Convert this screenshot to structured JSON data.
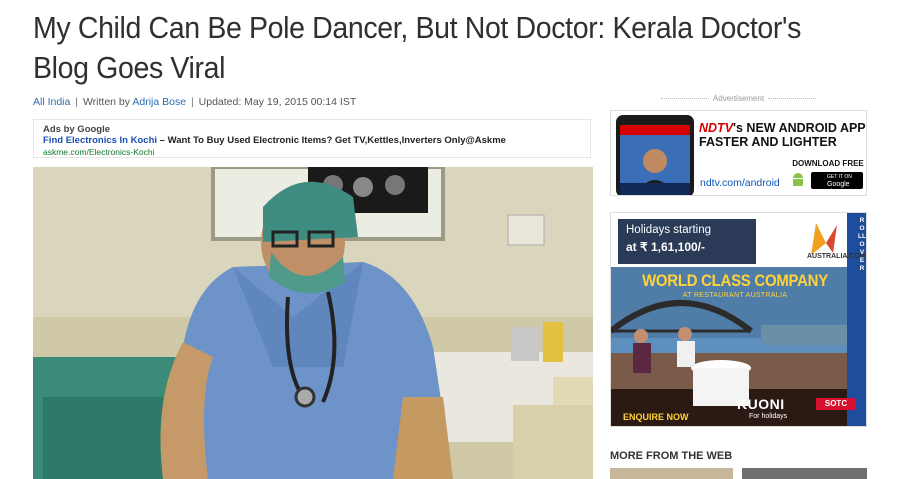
{
  "article": {
    "title": "My Child Can Be Pole Dancer, But Not Doctor: Kerala Doctor's Blog Goes Viral",
    "byline": {
      "section": "All India",
      "written_by_prefix": "Written by ",
      "author": "Adrija Bose",
      "updated": "Updated: May 19, 2015 00:14 IST",
      "separator": "|"
    }
  },
  "text_ad": {
    "ads_by": "Ads by Google",
    "link": "Find Electronics In Kochi",
    "dash": " – ",
    "text": "Want To Buy Used Electronic Items? Get TV,Kettles,Inverters Only@Askme",
    "url": "askme.com/Electronics-Kochi"
  },
  "sidebar": {
    "ad_label": "Advertisement",
    "ndtv_ad": {
      "brand": "NDTV",
      "headline_rest": "'s NEW ANDROID APP",
      "line2": "FASTER AND LIGHTER",
      "url": "ndtv.com/android",
      "download": "DOWNLOAD FREE",
      "store": "Google play",
      "store_prefix": "GET IT ON"
    },
    "kuoni_ad": {
      "line1": "Holidays starting",
      "line2": "at ₹ 1,61,100/-",
      "site": "AUSTRALIA.COM",
      "rollover": "ROLLOVER",
      "headline": "WORLD CLASS COMPANY",
      "sub": "AT RESTAURANT AUSTRALIA",
      "cta": "ENQUIRE NOW",
      "brand": "KUONI",
      "partner": "SOTC",
      "tagline": "For holidays"
    },
    "more_from_web": "MORE FROM THE WEB"
  },
  "colors": {
    "headline": "#303030",
    "link": "#2b6cb0",
    "ad_link": "#1a4fb5",
    "ad_url": "#0d7a2b",
    "ndtv_red": "#d60000",
    "kuoni_gold": "#ffd23a"
  }
}
